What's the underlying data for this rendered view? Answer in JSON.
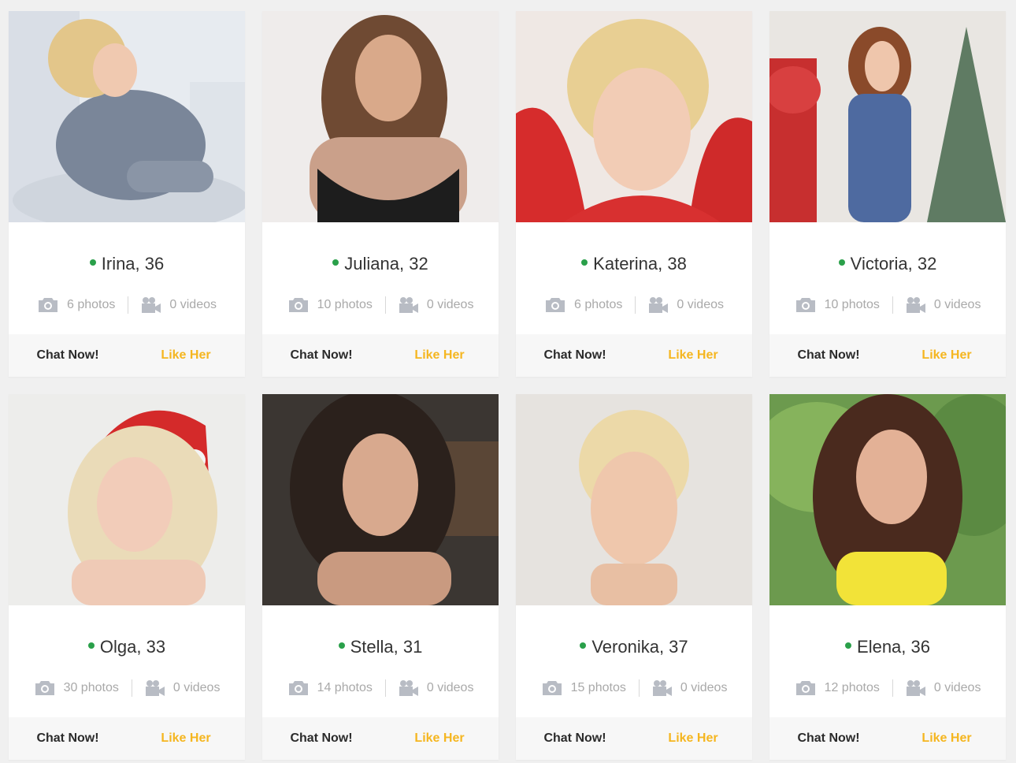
{
  "colors": {
    "online": "#2aa04a",
    "like": "#f5b620",
    "text": "#333333",
    "muted": "#a9a9a9"
  },
  "icons": {
    "photos": "camera-icon",
    "videos": "video-camera-icon"
  },
  "profiles": [
    {
      "name_age": "Irina, 36",
      "photos": "6 photos",
      "videos": "0 videos",
      "chat": "Chat Now!",
      "like": "Like Her"
    },
    {
      "name_age": "Juliana, 32",
      "photos": "10 photos",
      "videos": "0 videos",
      "chat": "Chat Now!",
      "like": "Like Her"
    },
    {
      "name_age": "Katerina, 38",
      "photos": "6 photos",
      "videos": "0 videos",
      "chat": "Chat Now!",
      "like": "Like Her"
    },
    {
      "name_age": "Victoria, 32",
      "photos": "10 photos",
      "videos": "0 videos",
      "chat": "Chat Now!",
      "like": "Like Her"
    },
    {
      "name_age": "Olga, 33",
      "photos": "30 photos",
      "videos": "0 videos",
      "chat": "Chat Now!",
      "like": "Like Her"
    },
    {
      "name_age": "Stella, 31",
      "photos": "14 photos",
      "videos": "0 videos",
      "chat": "Chat Now!",
      "like": "Like Her"
    },
    {
      "name_age": "Veronika, 37",
      "photos": "15 photos",
      "videos": "0 videos",
      "chat": "Chat Now!",
      "like": "Like Her"
    },
    {
      "name_age": "Elena, 36",
      "photos": "12 photos",
      "videos": "0 videos",
      "chat": "Chat Now!",
      "like": "Like Her"
    }
  ]
}
